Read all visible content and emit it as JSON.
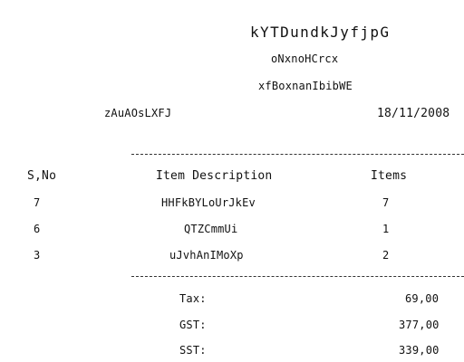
{
  "receipt": {
    "store_name": "kYTDundkJyfjpG",
    "line1": "oNxnoHCrcx",
    "line2": "xfBoxnanIbibWE",
    "cashier": "zAuAOsLXFJ",
    "date": "18/11/2008",
    "columns": {
      "sno": "S,No",
      "desc": "Item Description",
      "items": "Items"
    },
    "rows": [
      {
        "sno": "7",
        "desc": "HHFkBYLoUrJkEv",
        "qty": "7"
      },
      {
        "sno": "6",
        "desc": "QTZCmmUi",
        "qty": "1"
      },
      {
        "sno": "3",
        "desc": "uJvhAnIMoXp",
        "qty": "2"
      }
    ],
    "totals": [
      {
        "label": "Tax:",
        "value": "69,00"
      },
      {
        "label": "GST:",
        "value": "377,00"
      },
      {
        "label": "SST:",
        "value": "339,00"
      }
    ]
  }
}
